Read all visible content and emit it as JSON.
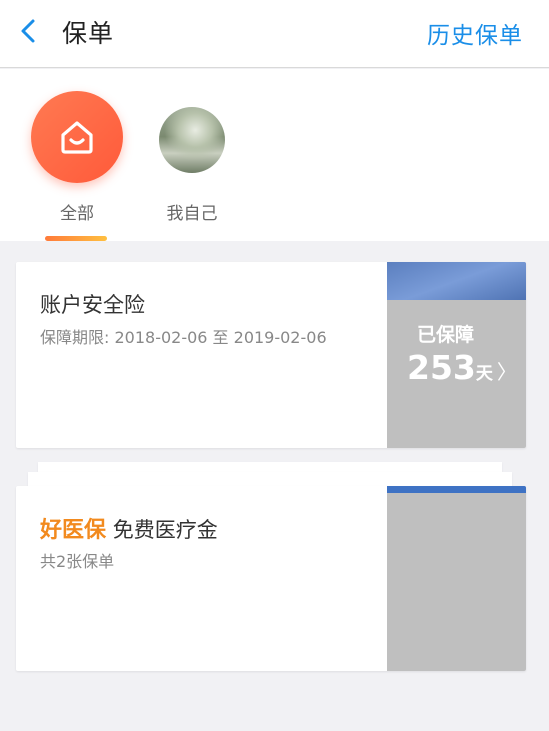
{
  "header": {
    "title": "保单",
    "history_link": "历史保单"
  },
  "filters": [
    {
      "label": "全部",
      "selected": true,
      "icon": "home-icon"
    },
    {
      "label": "我自己",
      "selected": false,
      "icon": "avatar-photo"
    }
  ],
  "policies": [
    {
      "name": "账户安全险",
      "period": "保障期限: 2018-02-06 至 2019-02-06",
      "status_label": "已保障",
      "days": "253",
      "days_unit": "天",
      "arrow": "〉"
    },
    {
      "brand": "好医保",
      "name": "免费医疗金",
      "count_text": "共2张保单"
    }
  ],
  "colors": {
    "accent": "#1a8ee8",
    "brand_orange": "#f28a1e",
    "avatar_gradient_start": "#ff7a52",
    "avatar_gradient_end": "#ff5a3a",
    "indicator_start": "#ff7a3a",
    "indicator_end": "#ffc040",
    "card_side": "#bfbfbf"
  }
}
